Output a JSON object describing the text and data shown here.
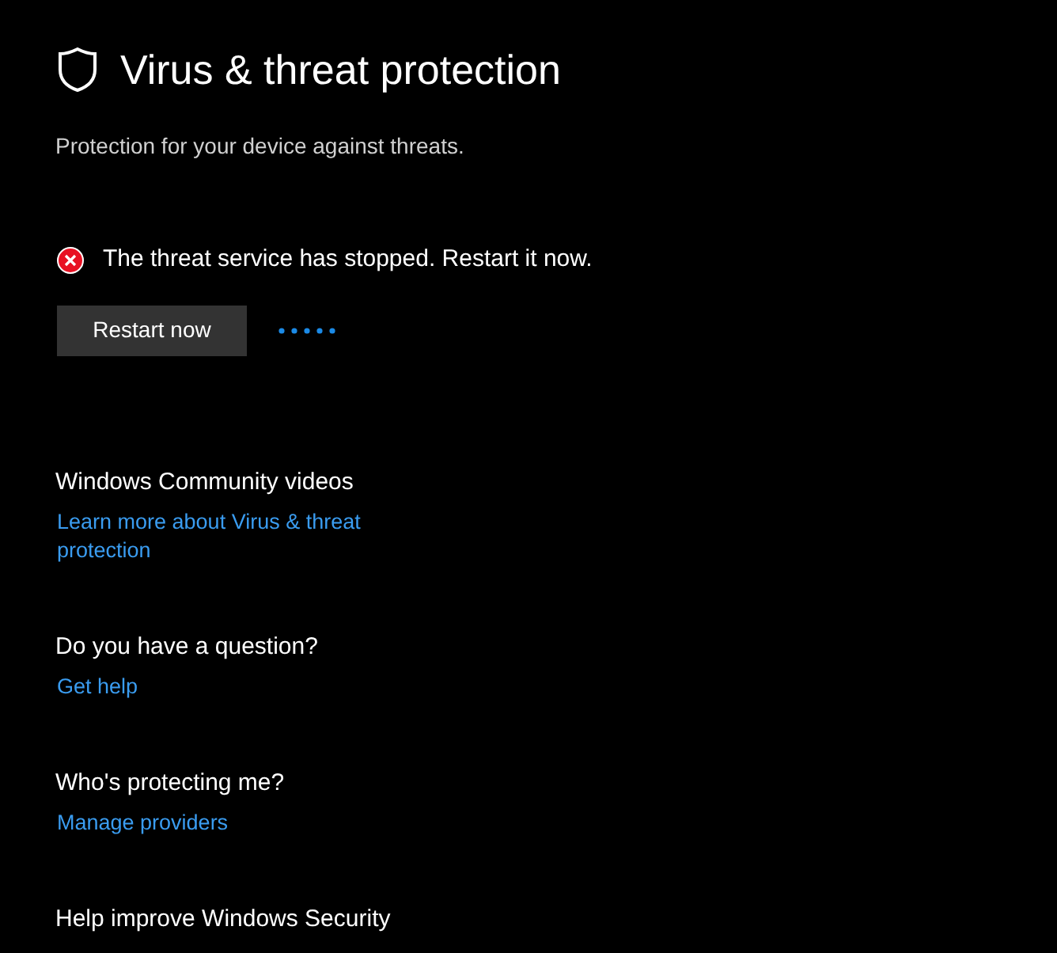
{
  "page": {
    "title": "Virus & threat protection",
    "subtitle": "Protection for your device against threats."
  },
  "alert": {
    "error": true,
    "message": "The threat service has stopped. Restart it now.",
    "button": "Restart now",
    "busy": true
  },
  "sections": [
    {
      "heading": "Windows Community videos",
      "links": [
        "Learn more about Virus & threat protection"
      ]
    },
    {
      "heading": "Do you have a question?",
      "links": [
        "Get help"
      ]
    },
    {
      "heading": "Who's protecting me?",
      "links": [
        "Manage providers"
      ]
    },
    {
      "heading": "Help improve Windows Security"
    }
  ]
}
